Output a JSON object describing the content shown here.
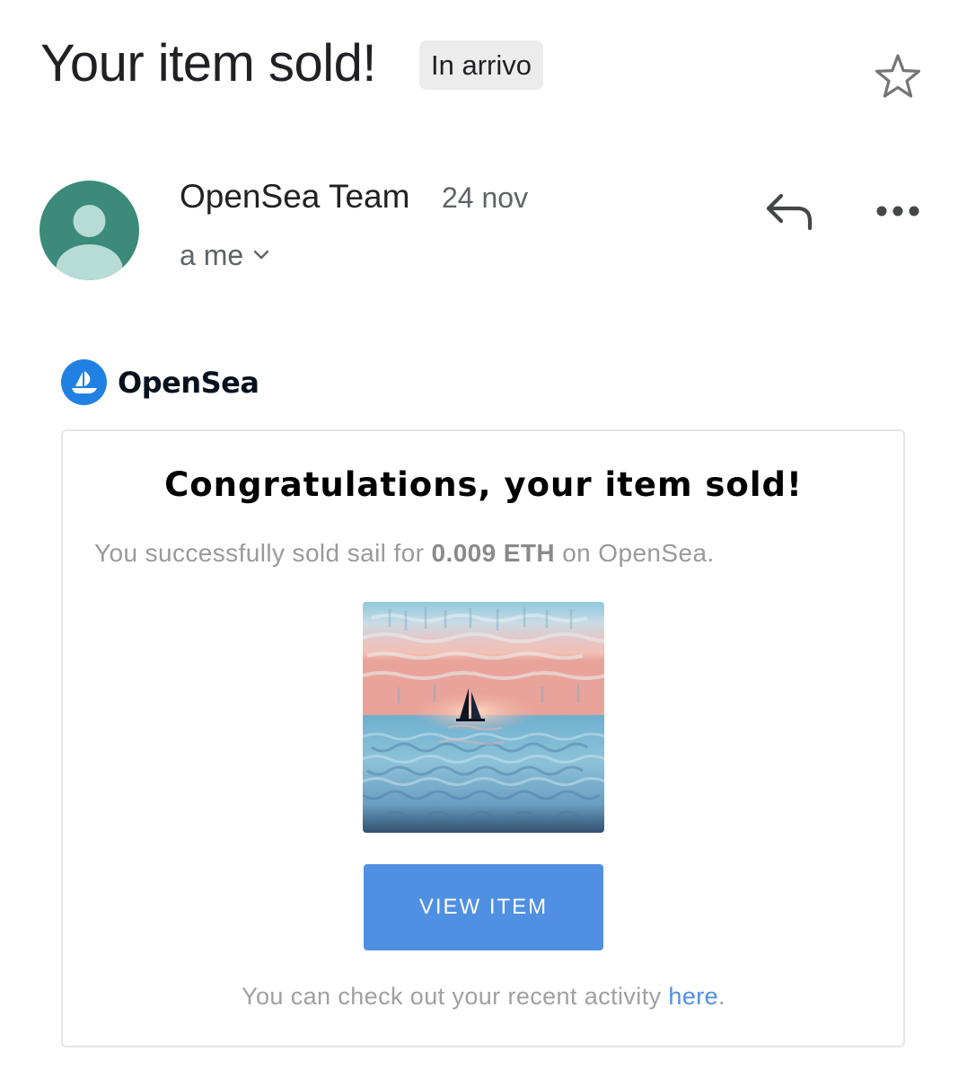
{
  "email": {
    "subject": "Your item sold!",
    "label": "In arrivo",
    "sender": {
      "name": "OpenSea Team",
      "date": "24 nov",
      "recipient": "a me"
    },
    "icons": {
      "star": "star-outline-icon",
      "reply": "reply-arrow-icon",
      "more": "more-horizontal-icon",
      "avatar": "person-silhouette-icon",
      "expand": "chevron-down-icon"
    }
  },
  "message": {
    "brand": {
      "name": "OpenSea",
      "logo_color": "#2081e2"
    },
    "headline": "Congratulations, your item sold!",
    "sale": {
      "prefix": "You successfully sold sail for",
      "amount": "0.009 ETH",
      "suffix": "on OpenSea."
    },
    "item_image": "sailboat-at-sea-painting",
    "button_label": "VIEW ITEM",
    "footer": {
      "text": "You can check out your recent activity",
      "link_text": "here",
      "end": "."
    }
  },
  "colors": {
    "avatar_bg": "#3b8a7a",
    "button_bg": "#5090e2",
    "link": "#5090e2"
  }
}
